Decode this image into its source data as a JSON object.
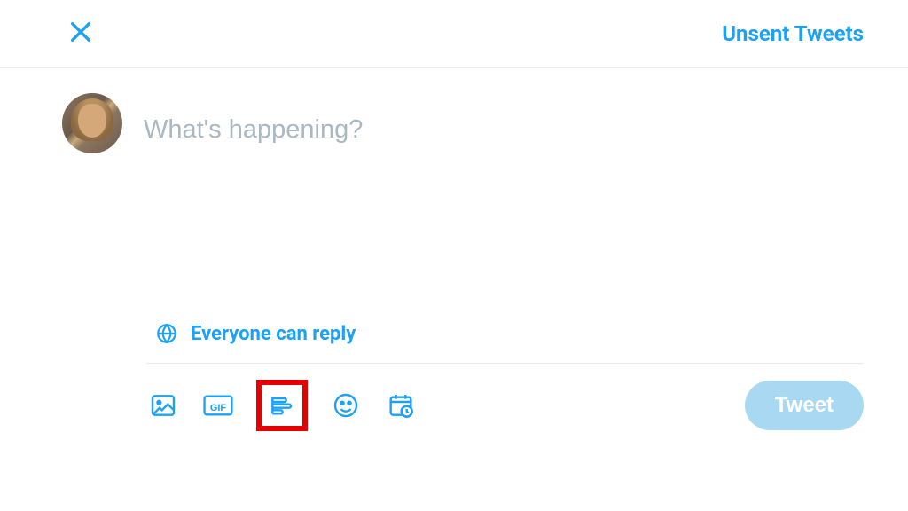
{
  "header": {
    "unsent_label": "Unsent Tweets"
  },
  "composer": {
    "placeholder": "What's happening?",
    "value": ""
  },
  "reply_settings": {
    "label": "Everyone can reply"
  },
  "toolbar": {
    "tweet_label": "Tweet",
    "icons": {
      "media": "media-icon",
      "gif": "gif-icon",
      "poll": "poll-icon",
      "emoji": "emoji-icon",
      "schedule": "schedule-icon"
    }
  },
  "colors": {
    "brand": "#1da1f2",
    "disabled_button": "#a8d8f2",
    "highlight": "#e60000"
  }
}
